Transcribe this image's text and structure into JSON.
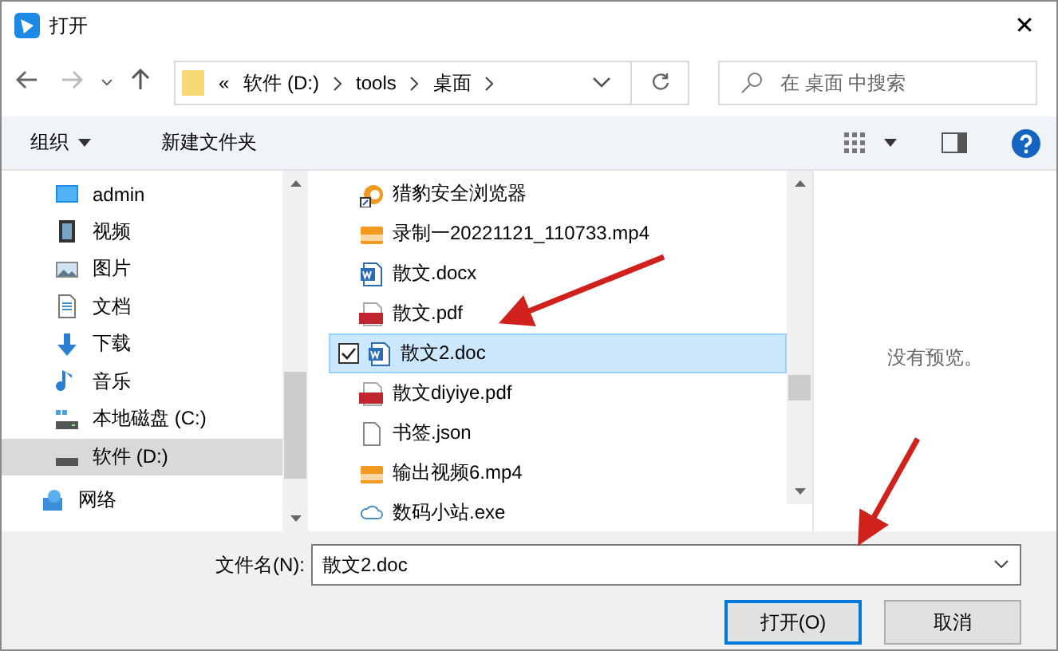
{
  "window": {
    "title": "打开",
    "close": "✕"
  },
  "address": {
    "overflow": "«",
    "crumbs": [
      "软件 (D:)",
      "tools",
      "桌面"
    ],
    "search_placeholder": "在 桌面 中搜索"
  },
  "toolbar": {
    "organize": "组织",
    "new_folder": "新建文件夹"
  },
  "nav_items": [
    {
      "label": "admin",
      "kind": "desktop",
      "selected": false
    },
    {
      "label": "视频",
      "kind": "videos",
      "selected": false
    },
    {
      "label": "图片",
      "kind": "pictures",
      "selected": false
    },
    {
      "label": "文档",
      "kind": "documents",
      "selected": false
    },
    {
      "label": "下载",
      "kind": "downloads",
      "selected": false
    },
    {
      "label": "音乐",
      "kind": "music",
      "selected": false
    },
    {
      "label": "本地磁盘 (C:)",
      "kind": "system-drive",
      "selected": false
    },
    {
      "label": "软件 (D:)",
      "kind": "drive",
      "selected": true
    }
  ],
  "network": {
    "label": "网络"
  },
  "files": [
    {
      "name": "猎豹安全浏览器",
      "kind": "shortcut",
      "selected": false
    },
    {
      "name": "录制一20221121_110733.mp4",
      "kind": "video",
      "selected": false
    },
    {
      "name": "散文.docx",
      "kind": "word",
      "selected": false
    },
    {
      "name": "散文.pdf",
      "kind": "pdf",
      "selected": false
    },
    {
      "name": "散文2.doc",
      "kind": "word",
      "selected": true
    },
    {
      "name": "散文diyiye.pdf",
      "kind": "pdf",
      "selected": false
    },
    {
      "name": "书签.json",
      "kind": "text",
      "selected": false
    },
    {
      "name": "输出视频6.mp4",
      "kind": "video",
      "selected": false
    },
    {
      "name": "数码小站.exe",
      "kind": "program",
      "selected": false
    }
  ],
  "preview": {
    "message": "没有预览。"
  },
  "footer": {
    "filename_label": "文件名(N):",
    "filename": "散文2.doc",
    "open": "打开(O)",
    "cancel": "取消"
  }
}
